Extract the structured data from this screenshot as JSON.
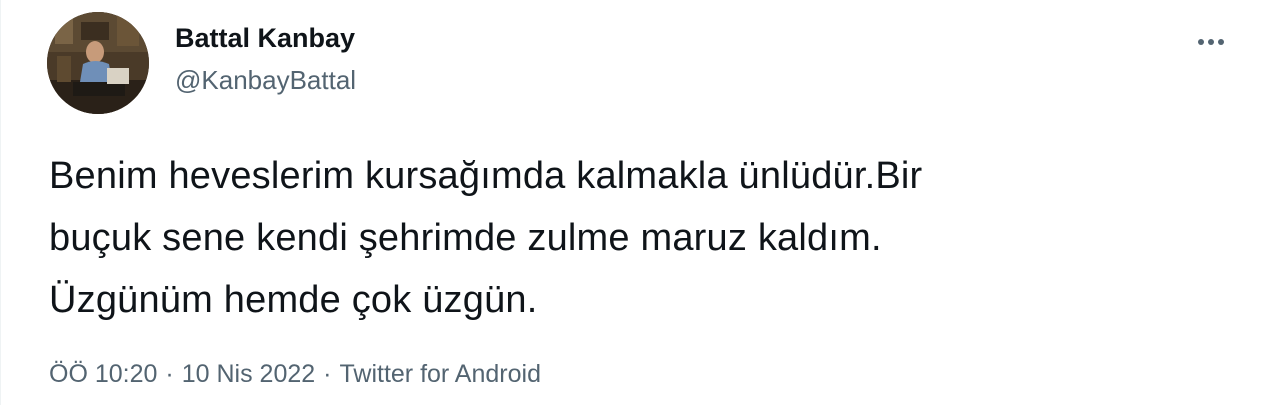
{
  "author": {
    "display_name": "Battal Kanbay",
    "handle": "@KanbayBattal"
  },
  "tweet": {
    "text_lines": [
      "Benim heveslerim kursağımda kalmakla ünlüdür.Bir",
      "buçuk sene kendi şehrimde zulme maruz kaldım.",
      "Üzgünüm hemde çok üzgün."
    ]
  },
  "meta": {
    "time": "ÖÖ 10:20",
    "separator": "·",
    "date": "10 Nis 2022",
    "source": "Twitter for Android"
  },
  "icons": {
    "more": "more-horizontal-icon"
  },
  "colors": {
    "text_primary": "#0f1419",
    "text_secondary": "#536471",
    "background": "#ffffff"
  }
}
